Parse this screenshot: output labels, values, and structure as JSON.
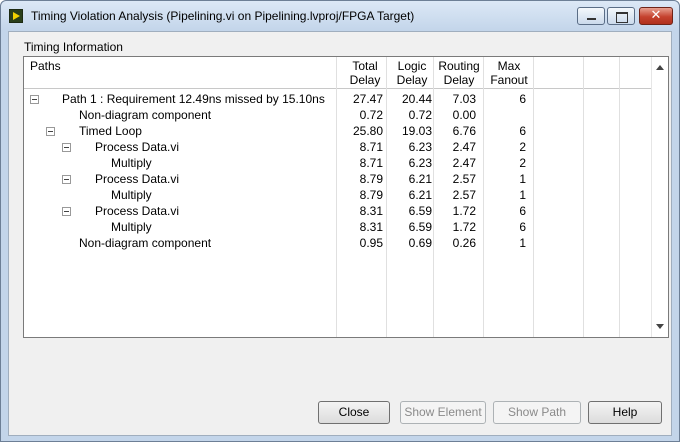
{
  "window": {
    "title": "Timing Violation Analysis (Pipelining.vi on Pipelining.lvproj/FPGA Target)",
    "close_glyph": "✕"
  },
  "group_label": "Timing Information",
  "table": {
    "headers": {
      "paths": "Paths",
      "total": [
        "Total",
        "Delay"
      ],
      "logic": [
        "Logic",
        "Delay"
      ],
      "routing": [
        "Routing",
        "Delay"
      ],
      "fanout": [
        "Max",
        "Fanout"
      ]
    },
    "rows": [
      {
        "path": "Path 1 : Requirement 12.49ns missed by 15.10ns",
        "total": "27.47",
        "logic": "20.44",
        "routing": "7.03",
        "fanout": "6"
      },
      {
        "path": "Non-diagram component",
        "total": "0.72",
        "logic": "0.72",
        "routing": "0.00",
        "fanout": ""
      },
      {
        "path": "Timed Loop",
        "total": "25.80",
        "logic": "19.03",
        "routing": "6.76",
        "fanout": "6"
      },
      {
        "path": "Process Data.vi",
        "total": "8.71",
        "logic": "6.23",
        "routing": "2.47",
        "fanout": "2"
      },
      {
        "path": "Multiply",
        "total": "8.71",
        "logic": "6.23",
        "routing": "2.47",
        "fanout": "2"
      },
      {
        "path": "Process Data.vi",
        "total": "8.79",
        "logic": "6.21",
        "routing": "2.57",
        "fanout": "1"
      },
      {
        "path": "Multiply",
        "total": "8.79",
        "logic": "6.21",
        "routing": "2.57",
        "fanout": "1"
      },
      {
        "path": "Process Data.vi",
        "total": "8.31",
        "logic": "6.59",
        "routing": "1.72",
        "fanout": "6"
      },
      {
        "path": "Multiply",
        "total": "8.31",
        "logic": "6.59",
        "routing": "1.72",
        "fanout": "6"
      },
      {
        "path": "Non-diagram component",
        "total": "0.95",
        "logic": "0.69",
        "routing": "0.26",
        "fanout": "1"
      }
    ]
  },
  "buttons": {
    "close": "Close",
    "show_element": "Show Element",
    "show_path": "Show Path",
    "help": "Help"
  }
}
